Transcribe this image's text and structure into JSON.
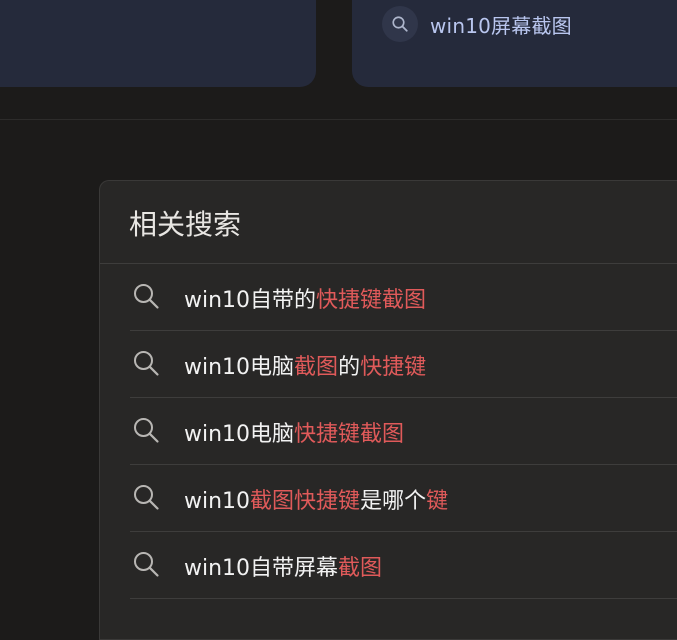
{
  "top_chip": {
    "text": "win10屏幕截图",
    "icon": "search-icon"
  },
  "related": {
    "title": "相关搜索",
    "items": [
      {
        "segments": [
          {
            "text": "win10自带的",
            "hl": false
          },
          {
            "text": "快捷键截图",
            "hl": true
          }
        ]
      },
      {
        "segments": [
          {
            "text": "win10电脑",
            "hl": false
          },
          {
            "text": "截图",
            "hl": true
          },
          {
            "text": "的",
            "hl": false
          },
          {
            "text": "快捷键",
            "hl": true
          }
        ]
      },
      {
        "segments": [
          {
            "text": "win10电脑",
            "hl": false
          },
          {
            "text": "快捷键截图",
            "hl": true
          }
        ]
      },
      {
        "segments": [
          {
            "text": "win10",
            "hl": false
          },
          {
            "text": "截图快捷键",
            "hl": true
          },
          {
            "text": "是哪个",
            "hl": false
          },
          {
            "text": "键",
            "hl": true
          }
        ]
      },
      {
        "segments": [
          {
            "text": "win10自带屏幕",
            "hl": false
          },
          {
            "text": "截图",
            "hl": true
          }
        ]
      }
    ]
  },
  "colors": {
    "highlight": "#e05a5a",
    "text": "#f2f2f2",
    "chip_text": "#b9c6ef",
    "panel_bg": "#282726"
  }
}
